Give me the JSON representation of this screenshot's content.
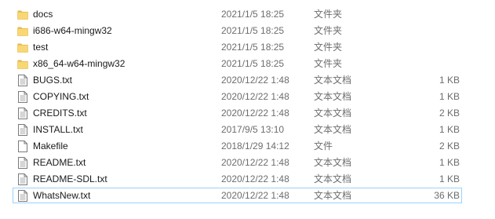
{
  "files": [
    {
      "name": "docs",
      "modified": "2021/1/5 18:25",
      "type": "文件夹",
      "size": "",
      "icon": "folder-icon",
      "selected": false
    },
    {
      "name": "i686-w64-mingw32",
      "modified": "2021/1/5 18:25",
      "type": "文件夹",
      "size": "",
      "icon": "folder-icon",
      "selected": false
    },
    {
      "name": "test",
      "modified": "2021/1/5 18:25",
      "type": "文件夹",
      "size": "",
      "icon": "folder-icon",
      "selected": false
    },
    {
      "name": "x86_64-w64-mingw32",
      "modified": "2021/1/5 18:25",
      "type": "文件夹",
      "size": "",
      "icon": "folder-icon",
      "selected": false
    },
    {
      "name": "BUGS.txt",
      "modified": "2020/12/22 1:48",
      "type": "文本文档",
      "size": "1 KB",
      "icon": "text-file-icon",
      "selected": false
    },
    {
      "name": "COPYING.txt",
      "modified": "2020/12/22 1:48",
      "type": "文本文档",
      "size": "1 KB",
      "icon": "text-file-icon",
      "selected": false
    },
    {
      "name": "CREDITS.txt",
      "modified": "2020/12/22 1:48",
      "type": "文本文档",
      "size": "2 KB",
      "icon": "text-file-icon",
      "selected": false
    },
    {
      "name": "INSTALL.txt",
      "modified": "2017/9/5 13:10",
      "type": "文本文档",
      "size": "1 KB",
      "icon": "text-file-icon",
      "selected": false
    },
    {
      "name": "Makefile",
      "modified": "2018/1/29 14:12",
      "type": "文件",
      "size": "2 KB",
      "icon": "blank-file-icon",
      "selected": false
    },
    {
      "name": "README.txt",
      "modified": "2020/12/22 1:48",
      "type": "文本文档",
      "size": "1 KB",
      "icon": "text-file-icon",
      "selected": false
    },
    {
      "name": "README-SDL.txt",
      "modified": "2020/12/22 1:48",
      "type": "文本文档",
      "size": "1 KB",
      "icon": "text-file-icon",
      "selected": false
    },
    {
      "name": "WhatsNew.txt",
      "modified": "2020/12/22 1:48",
      "type": "文本文档",
      "size": "36 KB",
      "icon": "text-file-icon",
      "selected": true
    }
  ],
  "colors": {
    "folder": "#f8d775",
    "folder_dark": "#e6b94a",
    "selection_border": "#99d1ff",
    "secondary_text": "#6d6d6d"
  }
}
